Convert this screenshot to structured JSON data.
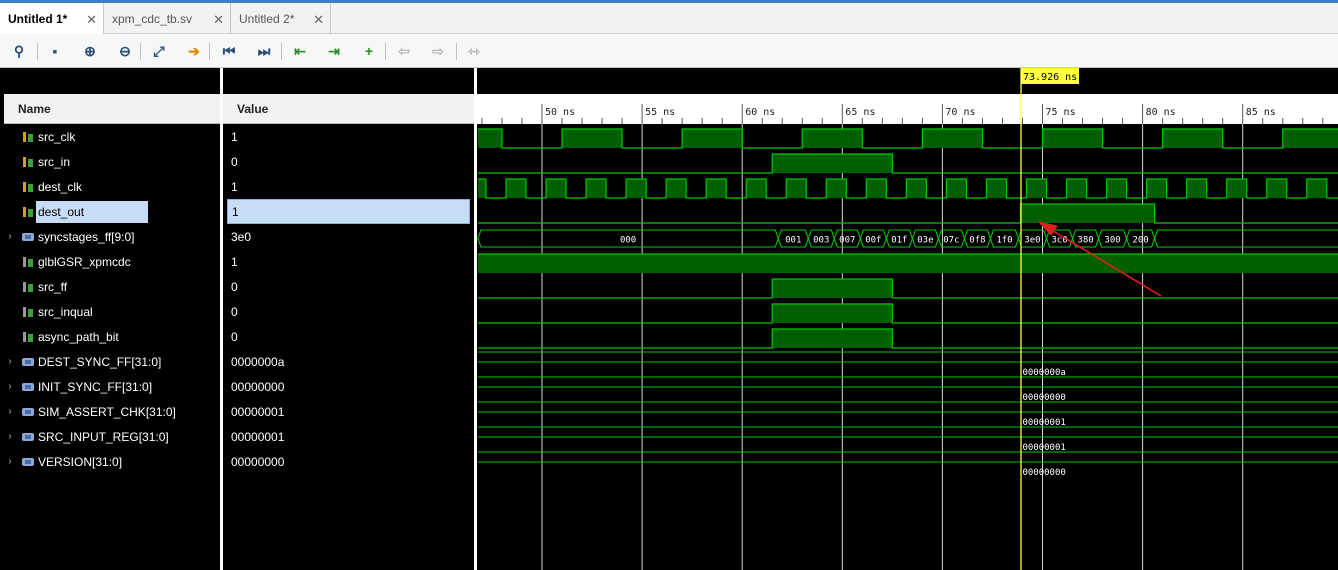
{
  "tabs": [
    {
      "label": "Untitled 1*",
      "close": "✕",
      "active": true
    },
    {
      "label": "xpm_cdc_tb.sv",
      "close": "✕",
      "active": false
    },
    {
      "label": "Untitled 2*",
      "close": "✕",
      "active": false
    }
  ],
  "toolbar": [
    {
      "name": "search-icon",
      "glyph": "⚲"
    },
    {
      "name": "save-icon",
      "glyph": "▪"
    },
    {
      "name": "zoom-in-icon",
      "glyph": "⊕"
    },
    {
      "name": "zoom-out-icon",
      "glyph": "⊖"
    },
    {
      "name": "zoom-fit-icon",
      "glyph": "⤢"
    },
    {
      "name": "go-to-cursor-icon",
      "glyph": "➔"
    },
    {
      "name": "go-to-time-0-icon",
      "glyph": "⏮"
    },
    {
      "name": "go-to-last-time-icon",
      "glyph": "⏭"
    },
    {
      "name": "previous-transition-icon",
      "glyph": "⇤"
    },
    {
      "name": "next-transition-icon",
      "glyph": "⇥"
    },
    {
      "name": "add-marker-icon",
      "glyph": "+"
    },
    {
      "name": "previous-marker-icon",
      "glyph": "⇦"
    },
    {
      "name": "next-marker-icon",
      "glyph": "⇨"
    },
    {
      "name": "swap-cursors-icon",
      "glyph": "⇿"
    }
  ],
  "columns": {
    "name": "Name",
    "value": "Value"
  },
  "signals": [
    {
      "name": "src_clk",
      "value": "1",
      "type": "sig",
      "expandable": false
    },
    {
      "name": "src_in",
      "value": "0",
      "type": "sig",
      "expandable": false
    },
    {
      "name": "dest_clk",
      "value": "1",
      "type": "sig",
      "expandable": false
    },
    {
      "name": "dest_out",
      "value": "1",
      "type": "sig",
      "expandable": false,
      "selected": true
    },
    {
      "name": "syncstages_ff[9:0]",
      "value": "3e0",
      "type": "bus",
      "expandable": true
    },
    {
      "name": "glblGSR_xpmcdc",
      "value": "1",
      "type": "sigg",
      "expandable": false
    },
    {
      "name": "src_ff",
      "value": "0",
      "type": "sigg",
      "expandable": false
    },
    {
      "name": "src_inqual",
      "value": "0",
      "type": "sigg",
      "expandable": false
    },
    {
      "name": "async_path_bit",
      "value": "0",
      "type": "sigg",
      "expandable": false
    },
    {
      "name": "DEST_SYNC_FF[31:0]",
      "value": "0000000a",
      "type": "bus",
      "expandable": true
    },
    {
      "name": "INIT_SYNC_FF[31:0]",
      "value": "00000000",
      "type": "bus",
      "expandable": true
    },
    {
      "name": "SIM_ASSERT_CHK[31:0]",
      "value": "00000001",
      "type": "bus",
      "expandable": true
    },
    {
      "name": "SRC_INPUT_REG[31:0]",
      "value": "00000001",
      "type": "bus",
      "expandable": true
    },
    {
      "name": "VERSION[31:0]",
      "value": "00000000",
      "type": "bus",
      "expandable": true
    }
  ],
  "timeline": {
    "cursor_label": "73.926 ns",
    "cursor_time": 73.926,
    "ticks": [
      {
        "t": 50,
        "label": "50 ns"
      },
      {
        "t": 55,
        "label": "55 ns"
      },
      {
        "t": 60,
        "label": "60 ns"
      },
      {
        "t": 65,
        "label": "65 ns"
      },
      {
        "t": 70,
        "label": "70 ns"
      },
      {
        "t": 75,
        "label": "75 ns"
      },
      {
        "t": 80,
        "label": "80 ns"
      },
      {
        "t": 85,
        "label": "85 ns"
      }
    ]
  },
  "syncstages_values": [
    "000",
    "001",
    "003",
    "007",
    "00f",
    "01f",
    "03e",
    "07c",
    "0f8",
    "1f0",
    "3e0",
    "3c0",
    "380",
    "300",
    "200"
  ],
  "bus_labels": [
    "0000000a",
    "00000000",
    "00000001",
    "00000001",
    "00000000"
  ],
  "colors": {
    "wave": "#00c800",
    "fill": "#005f00",
    "cursor": "#ffff40",
    "arrow": "#e02020",
    "grid": "#d8d8d8"
  }
}
